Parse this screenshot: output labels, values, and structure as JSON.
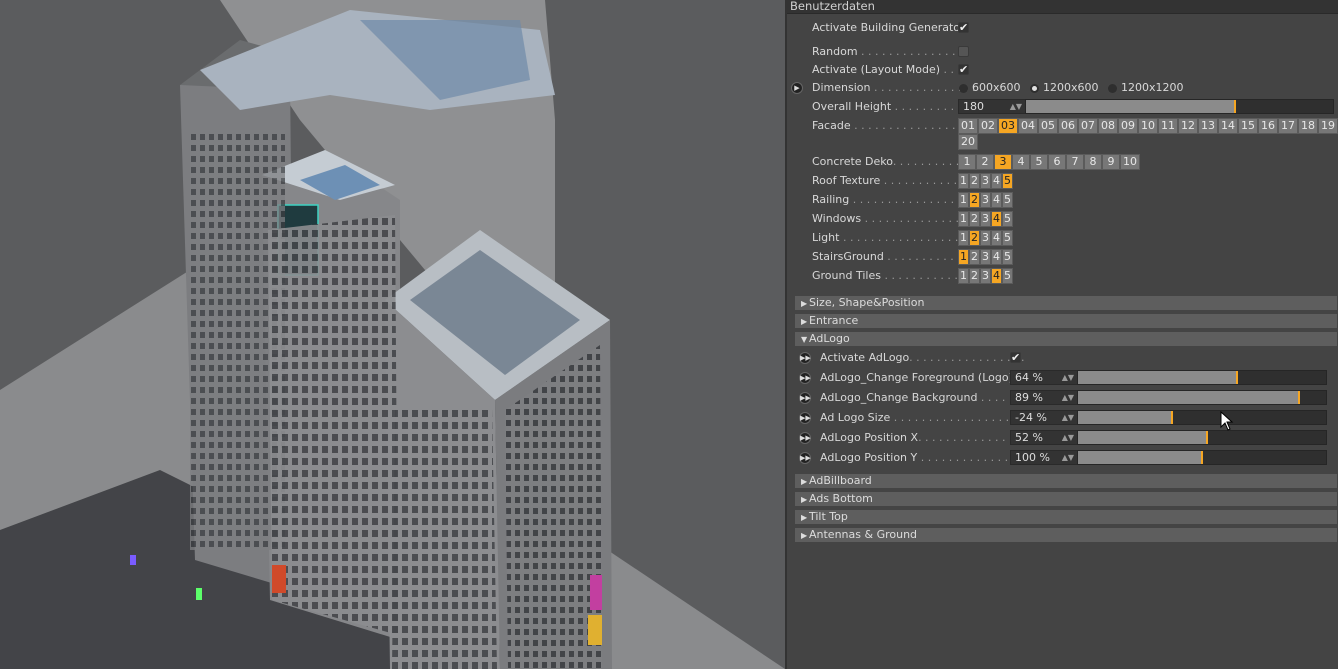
{
  "panel": {
    "header": "Benutzerdaten",
    "activate_building_generator": {
      "label": "Activate Building Generator",
      "checked": true
    },
    "random": {
      "label": "Random",
      "dots": " . . . . . . . . . . . . . . . . ",
      "checked": false
    },
    "activate_layout_mode": {
      "label": "Activate (Layout Mode)",
      "dots": " . . . .",
      "checked": true
    },
    "dimension": {
      "label": "Dimension",
      "dots": " . . . . . . . . . . . . . . .",
      "options": [
        "600x600",
        "1200x600",
        "1200x1200"
      ],
      "selected": "1200x600"
    },
    "overall_height": {
      "label": "Overall Height",
      "dots": " . . . . . . . . . . . .",
      "value": "180",
      "slider_fraction": 0.68
    },
    "facade": {
      "label": "Facade",
      "dots": " . . . . . . . . . . . . . . . . . . . .",
      "options": [
        "01",
        "02",
        "03",
        "04",
        "05",
        "06",
        "07",
        "08",
        "09",
        "10",
        "11",
        "12",
        "13",
        "14",
        "15",
        "16",
        "17",
        "18",
        "19",
        "20"
      ],
      "selected": "03"
    },
    "concrete_deko": {
      "label": "Concrete Deko",
      "dots": ". . . . . . . . . . . .",
      "options": [
        "1",
        "2",
        "3",
        "4",
        "5",
        "6",
        "7",
        "8",
        "9",
        "10"
      ],
      "selected": "3"
    },
    "roof_texture": {
      "label": "Roof Texture",
      "dots": " . . . . . . . . . . . . .",
      "options": [
        "1",
        "2",
        "3",
        "4",
        "5"
      ],
      "selected": "5"
    },
    "railing": {
      "label": "Railing",
      "dots": " . . . . . . . . . . . . . . . . . . .",
      "options": [
        "1",
        "2",
        "3",
        "4",
        "5"
      ],
      "selected": "2"
    },
    "windows": {
      "label": "Windows",
      "dots": " . . . . . . . . . . . . . . . . .",
      "options": [
        "1",
        "2",
        "3",
        "4",
        "5"
      ],
      "selected": "4"
    },
    "light": {
      "label": "Light",
      "dots": " . . . . . . . . . . . . . . . . . . . . .",
      "options": [
        "1",
        "2",
        "3",
        "4",
        "5"
      ],
      "selected": "2"
    },
    "stairs_ground": {
      "label": "StairsGround",
      "dots": " . . . . . . . . . . .",
      "options": [
        "1",
        "2",
        "3",
        "4",
        "5"
      ],
      "selected": "1"
    },
    "ground_tiles": {
      "label": "Ground Tiles",
      "dots": " . . . . . . . . . . . . .",
      "options": [
        "1",
        "2",
        "3",
        "4",
        "5"
      ],
      "selected": "4"
    },
    "sections_top": [
      "Size, Shape&Position",
      "Entrance"
    ],
    "adlogo": {
      "title": "AdLogo",
      "activate": {
        "label": "Activate AdLogo",
        "dots": ". . . . . . . . . . . . . . . . .",
        "checked": true
      },
      "params": [
        {
          "label": "AdLogo_Change Foreground (Logo)",
          "dots": "",
          "value": "64 %",
          "fraction": 0.64
        },
        {
          "label": "AdLogo_Change Background",
          "dots": " . . . . .",
          "value": "89 %",
          "fraction": 0.89
        },
        {
          "label": "Ad Logo Size",
          "dots": " . . . . . . . . . . . . . . . . . . . .",
          "value": "-24 %",
          "fraction": 0.38
        },
        {
          "label": "AdLogo Position X",
          "dots": ". . . . . . . . . . . . . . .",
          "value": "52 %",
          "fraction": 0.52
        },
        {
          "label": "AdLogo Position Y",
          "dots": " . . . . . . . . . . . . . .",
          "value": "100 %",
          "fraction": 0.5
        }
      ]
    },
    "sections_bottom": [
      "AdBillboard",
      "Ads Bottom",
      "Tilt Top",
      "Antennas & Ground"
    ]
  },
  "colors": {
    "accent": "#f5a623",
    "panel_bg": "#444444",
    "section_bg": "#5e5e5e",
    "viewport_bg": "#5a5b5d"
  }
}
